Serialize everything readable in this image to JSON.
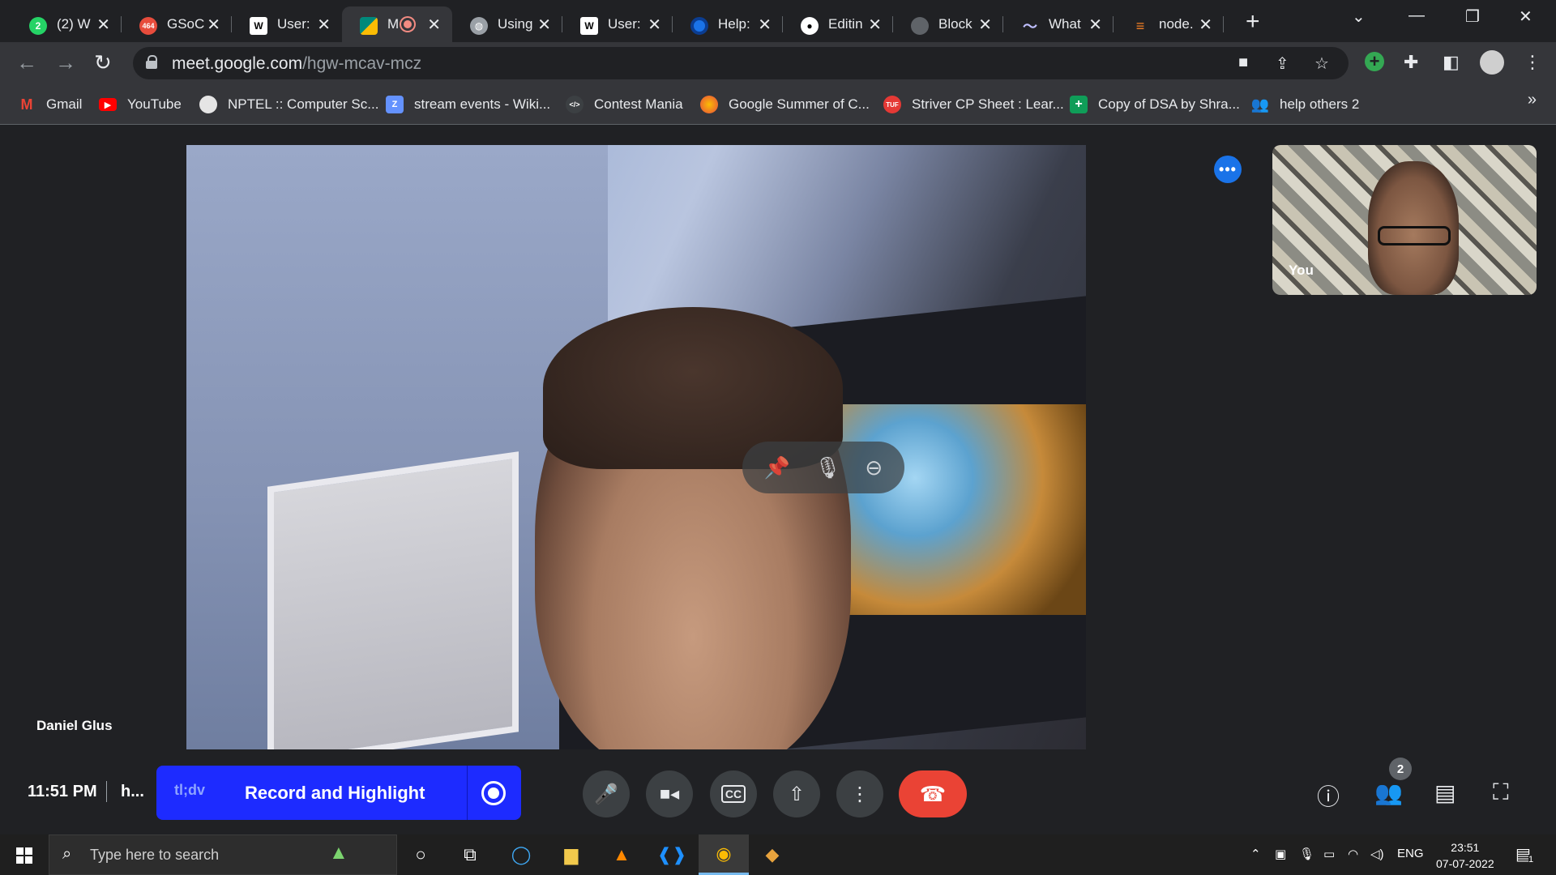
{
  "browser": {
    "tabs": [
      {
        "title": "(2) W",
        "favicon": "whatsapp-icon",
        "color": "#25d366",
        "glyph": "2"
      },
      {
        "title": "GSoC",
        "favicon": "gsoc-icon",
        "color": "#e74c3c",
        "glyph": "464"
      },
      {
        "title": "User:",
        "favicon": "wikipedia-icon",
        "color": "#ffffff",
        "glyph": "W"
      },
      {
        "title": "M",
        "favicon": "google-meet-icon",
        "color": "#00897b",
        "glyph": ""
      },
      {
        "title": "Using",
        "favicon": "globe-icon",
        "color": "#9aa0a6",
        "glyph": ""
      },
      {
        "title": "User:",
        "favicon": "wikipedia-icon",
        "color": "#ffffff",
        "glyph": "W"
      },
      {
        "title": "Help:",
        "favicon": "help-icon",
        "color": "#1a73e8",
        "glyph": ""
      },
      {
        "title": "Editin",
        "favicon": "github-icon",
        "color": "#ffffff",
        "glyph": ""
      },
      {
        "title": "Block",
        "favicon": "block-icon",
        "color": "#5f6368",
        "glyph": ""
      },
      {
        "title": "What",
        "favicon": "what-icon",
        "color": "#c0c0ff",
        "glyph": ""
      },
      {
        "title": "node.",
        "favicon": "stackoverflow-icon",
        "color": "#f48024",
        "glyph": ""
      }
    ],
    "url_domain": "meet.google.com",
    "url_path": "/hgw-mcav-mcz",
    "bookmarks": [
      {
        "label": "Gmail",
        "icon": "gmail-icon",
        "color": "#ea4335",
        "glyph": "M"
      },
      {
        "label": "YouTube",
        "icon": "youtube-icon",
        "color": "#ff0000",
        "glyph": "▶"
      },
      {
        "label": "NPTEL :: Computer Sc...",
        "icon": "nptel-icon",
        "color": "#e5e5e5",
        "glyph": ""
      },
      {
        "label": "stream events - Wiki...",
        "icon": "zulip-icon",
        "color": "#6492fe",
        "glyph": "Z"
      },
      {
        "label": "Contest Mania",
        "icon": "code-icon",
        "color": "#3c4043",
        "glyph": "</>"
      },
      {
        "label": "Google Summer of C...",
        "icon": "gsoc-icon",
        "color": "#e74c3c",
        "glyph": ""
      },
      {
        "label": "Striver CP Sheet : Lear...",
        "icon": "tuf-icon",
        "color": "#e53935",
        "glyph": "TUF"
      },
      {
        "label": "Copy of DSA by Shra...",
        "icon": "sheets-icon",
        "color": "#0f9d58",
        "glyph": "+"
      },
      {
        "label": "help others 2",
        "icon": "people-icon",
        "color": "#4285f4",
        "glyph": "♟"
      }
    ],
    "bookmarks_more": "»"
  },
  "meet": {
    "main_participant": "Daniel Glus",
    "self_label": "You",
    "clock": "11:51 PM",
    "meeting_code": "h...",
    "extension": {
      "logo": "tl;dv",
      "label": "Record and Highlight"
    },
    "participant_count": "2",
    "accent_blue": "#1a73e8",
    "leave_red": "#ea4335",
    "extension_blue": "#1d2bff"
  },
  "taskbar": {
    "search_placeholder": "Type here to search",
    "language": "ENG",
    "time": "23:51",
    "date": "07-07-2022",
    "notification_count": "1"
  }
}
